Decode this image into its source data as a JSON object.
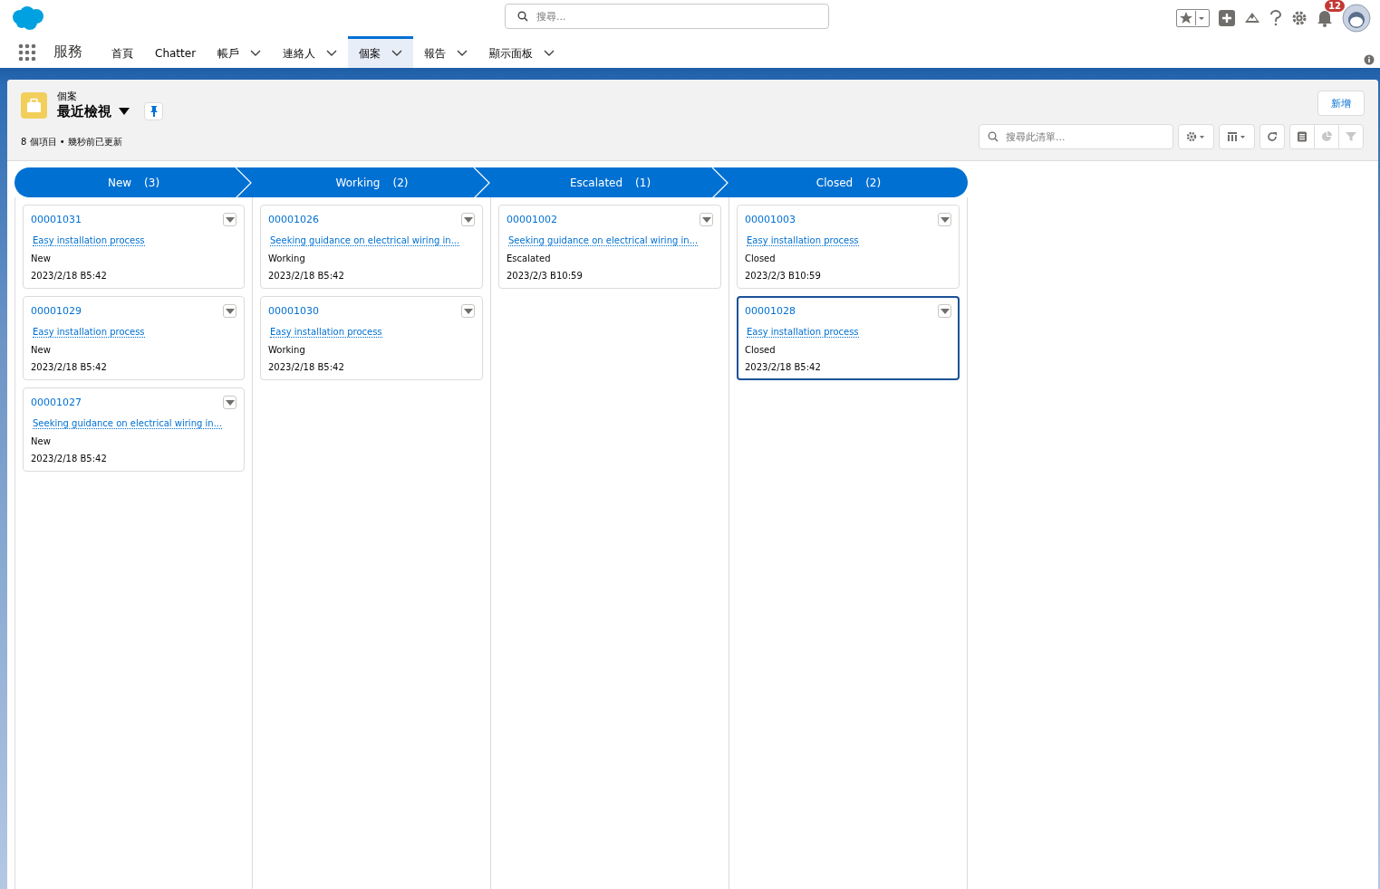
{
  "header": {
    "search_placeholder": "搜尋...",
    "notification_count": "12"
  },
  "app": {
    "name": "服務"
  },
  "nav": [
    {
      "label": "首頁",
      "has_menu": false,
      "selected": false
    },
    {
      "label": "Chatter",
      "has_menu": false,
      "selected": false
    },
    {
      "label": "帳戶",
      "has_menu": true,
      "selected": false
    },
    {
      "label": "連絡人",
      "has_menu": true,
      "selected": false
    },
    {
      "label": "個案",
      "has_menu": true,
      "selected": true
    },
    {
      "label": "報告",
      "has_menu": true,
      "selected": false
    },
    {
      "label": "顯示面板",
      "has_menu": true,
      "selected": false
    }
  ],
  "list_header": {
    "object": "個案",
    "view": "最近檢視",
    "status": "8 個項目 • 幾秒前已更新",
    "new_button": "新增",
    "search_placeholder": "搜尋此清單..."
  },
  "columns": [
    {
      "title": "New",
      "count": "(3)",
      "cards": [
        {
          "number": "00001031",
          "subject": "Easy installation process",
          "status": "New",
          "date": "2023/2/18 B5:42",
          "selected": false
        },
        {
          "number": "00001029",
          "subject": "Easy installation process",
          "status": "New",
          "date": "2023/2/18 B5:42",
          "selected": false
        },
        {
          "number": "00001027",
          "subject": "Seeking guidance on electrical wiring in...",
          "status": "New",
          "date": "2023/2/18 B5:42",
          "selected": false
        }
      ]
    },
    {
      "title": "Working",
      "count": "(2)",
      "cards": [
        {
          "number": "00001026",
          "subject": "Seeking guidance on electrical wiring in...",
          "status": "Working",
          "date": "2023/2/18 B5:42",
          "selected": false
        },
        {
          "number": "00001030",
          "subject": "Easy installation process",
          "status": "Working",
          "date": "2023/2/18 B5:42",
          "selected": false
        }
      ]
    },
    {
      "title": "Escalated",
      "count": "(1)",
      "cards": [
        {
          "number": "00001002",
          "subject": "Seeking guidance on electrical wiring in...",
          "status": "Escalated",
          "date": "2023/2/3 B10:59",
          "selected": false
        }
      ]
    },
    {
      "title": "Closed",
      "count": "(2)",
      "cards": [
        {
          "number": "00001003",
          "subject": "Easy installation process",
          "status": "Closed",
          "date": "2023/2/3 B10:59",
          "selected": false
        },
        {
          "number": "00001028",
          "subject": "Easy installation process",
          "status": "Closed",
          "date": "2023/2/18 B5:42",
          "selected": true
        }
      ]
    }
  ]
}
